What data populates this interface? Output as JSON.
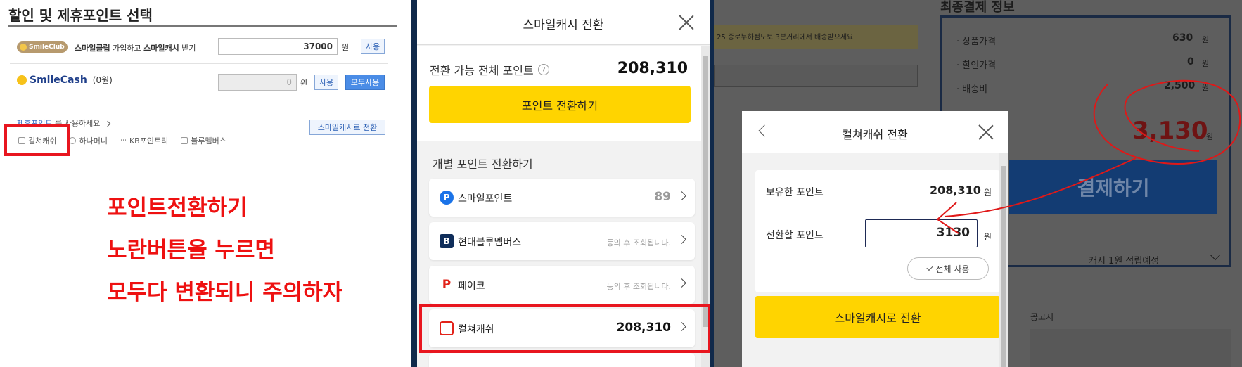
{
  "panel1": {
    "title": "할인 및 제휴포인트 선택",
    "smileclub": {
      "logo_text": "SmileClub",
      "text_prefix": "스마일클럽",
      "text_middle": " 가입하고 ",
      "text_strong": "스마일캐시",
      "text_suffix": " 받기",
      "input_value": "37000",
      "unit": "원",
      "use_button": "사용"
    },
    "smilecash": {
      "logo_text": "SmileCash",
      "balance": "(0원)",
      "input_value": "0",
      "unit": "원",
      "use_button": "사용",
      "use_all_button": "모두사용"
    },
    "partner": {
      "prompt_link": "제휴포인트",
      "prompt_rest": " 를 사용하세요",
      "convert_button": "스마일캐시로 전환",
      "items": [
        "컬쳐캐쉬",
        "하나머니",
        "KB포인트리",
        "블루멤버스"
      ]
    },
    "annotation": [
      "포인트전환하기",
      "노란버튼을 누르면",
      "모두다 변환되니 주의하자"
    ]
  },
  "panel2": {
    "modal_title": "스마일캐시 전환",
    "total_label": "전환 가능 전체 포인트",
    "total_value": "208,310",
    "convert_all_button": "포인트 전환하기",
    "section_title": "개별 포인트 전환하기",
    "points": [
      {
        "icon": "P",
        "name": "스마일포인트",
        "value": "89"
      },
      {
        "icon": "B",
        "name": "현대블루멤버스",
        "value": "동의 후 조회됩니다."
      },
      {
        "icon": "P",
        "name": "페이코",
        "value": "동의 후 조회됩니다."
      },
      {
        "icon": "컬쳐캐쉬",
        "name": "컬쳐캐쉬",
        "value": "208,310"
      }
    ]
  },
  "panel3": {
    "background": {
      "delivery_note": "25 종로누하점도보 3분거리에서 배송받으세요",
      "payment_title": "최종결제 정보",
      "rows": [
        {
          "label": "· 상품가격",
          "value": "630",
          "unit": "원"
        },
        {
          "label": "· 할인가격",
          "value": "0",
          "unit": "원"
        },
        {
          "label": "· 배송비",
          "value": "2,500",
          "unit": "원"
        }
      ],
      "total_value": "3,130",
      "total_unit": "원",
      "pay_button": "결제하기",
      "earn_text": "캐시 1원 적립예정",
      "notice": "공고지"
    },
    "modal_title": "컬쳐캐쉬 전환",
    "owned_label": "보유한 포인트",
    "owned_value": "208,310",
    "owned_unit": "원",
    "convert_label": "전환할 포인트",
    "convert_value": "3130",
    "convert_unit": "원",
    "use_all_button": "전체 사용",
    "submit_button": "스마일캐시로 전환"
  },
  "colors": {
    "annotation_red": "#e8161f",
    "button_yellow": "#ffd400",
    "navy": "#1e2a55"
  }
}
